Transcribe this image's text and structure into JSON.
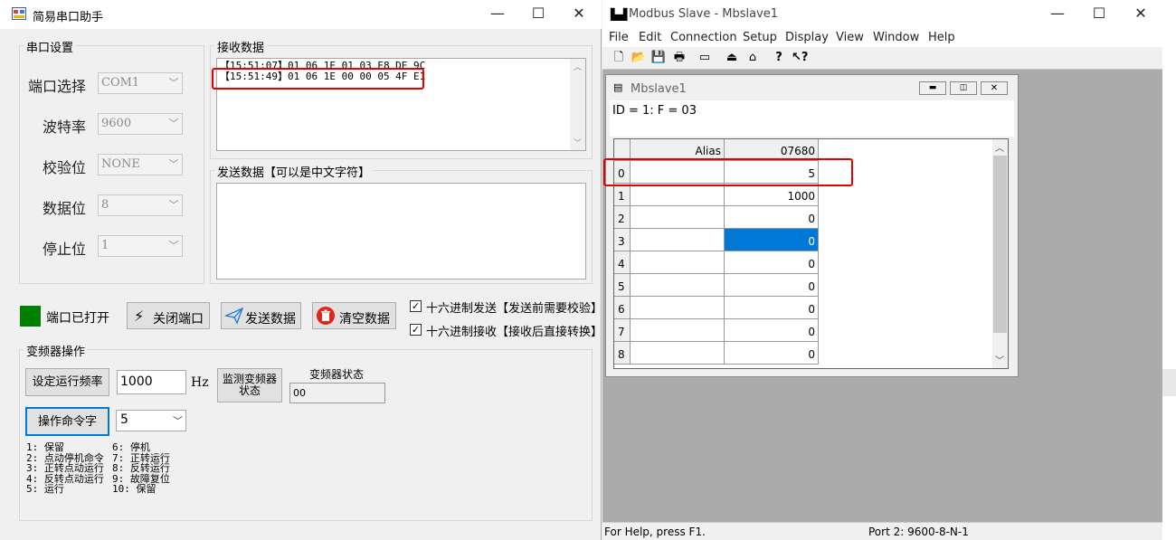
{
  "serial_tool": {
    "title": "简易串口助手",
    "window_controls": {
      "minimize": "—",
      "maximize": "☐",
      "close": "✕"
    },
    "port_settings": {
      "group_label": "串口设置",
      "port_label": "端口选择",
      "port_value": "COM1",
      "baud_label": "波特率",
      "baud_value": "9600",
      "parity_label": "校验位",
      "parity_value": "NONE",
      "databits_label": "数据位",
      "databits_value": "8",
      "stopbits_label": "停止位",
      "stopbits_value": "1"
    },
    "receive": {
      "group_label": "接收数据",
      "lines": [
        "【15:51:07】01 06 1E 01 03 E8 DE 9C",
        "【15:51:49】01 06 1E 00 00 05 4F E1"
      ]
    },
    "send": {
      "group_label": "发送数据【可以是中文字符】",
      "value": ""
    },
    "status": {
      "indicator_color": "#008000",
      "label": "端口已打开"
    },
    "buttons": {
      "close_port": "关闭端口",
      "send_data": "发送数据",
      "clear_data": "清空数据"
    },
    "options": {
      "hex_send": "十六进制发送【发送前需要校验】",
      "hex_send_checked": true,
      "hex_receive": "十六进制接收【接收后直接转换】",
      "hex_receive_checked": true
    },
    "vfd": {
      "group_label": "变频器操作",
      "set_freq_button": "设定运行频率",
      "freq_value": "1000",
      "freq_unit": "Hz",
      "monitor_button_line1": "监测变频器",
      "monitor_button_line2": "状态",
      "status_label": "变频器状态",
      "status_value": "00",
      "command_button": "操作命令字",
      "command_value": "5",
      "legend_left": [
        "1: 保留",
        "2: 点动停机命令",
        "3: 正转点动运行",
        "4: 反转点动运行",
        "5: 运行"
      ],
      "legend_right": [
        "6: 停机",
        "7: 正转运行",
        "8: 反转运行",
        "9: 故障复位",
        "10: 保留"
      ]
    }
  },
  "modbus_slave": {
    "title": "Modbus Slave - Mbslave1",
    "window_controls": {
      "minimize": "—",
      "maximize": "☐",
      "close": "✕"
    },
    "menu": [
      "File",
      "Edit",
      "Connection",
      "Setup",
      "Display",
      "View",
      "Window",
      "Help"
    ],
    "toolbar_icons": [
      "new-icon",
      "open-icon",
      "save-icon",
      "print-icon",
      "window-icon",
      "connect-icon",
      "disconnect-icon",
      "help-icon",
      "context-help-icon"
    ],
    "child": {
      "title": "Mbslave1",
      "header": "ID = 1: F = 03",
      "alias_header": "Alias",
      "address_header": "07680",
      "rows": [
        {
          "index": "0",
          "alias": "",
          "value": "5"
        },
        {
          "index": "1",
          "alias": "",
          "value": "1000"
        },
        {
          "index": "2",
          "alias": "",
          "value": "0"
        },
        {
          "index": "3",
          "alias": "",
          "value": "0"
        },
        {
          "index": "4",
          "alias": "",
          "value": "0"
        },
        {
          "index": "5",
          "alias": "",
          "value": "0"
        },
        {
          "index": "6",
          "alias": "",
          "value": "0"
        },
        {
          "index": "7",
          "alias": "",
          "value": "0"
        },
        {
          "index": "8",
          "alias": "",
          "value": "0"
        }
      ],
      "selected_row": 3,
      "selected_color": "#0078d7"
    },
    "status_left": "For Help, press F1.",
    "status_right": "Port 2: 9600-8-N-1"
  }
}
